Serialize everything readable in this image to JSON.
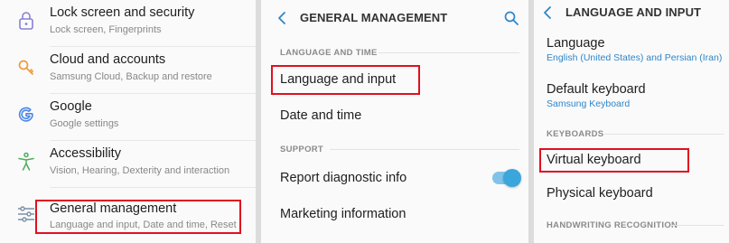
{
  "panel1": {
    "items": [
      {
        "title": "Lock screen and security",
        "subtitle": "Lock screen, Fingerprints",
        "icon": "lock-icon"
      },
      {
        "title": "Cloud and accounts",
        "subtitle": "Samsung Cloud, Backup and restore",
        "icon": "key-icon"
      },
      {
        "title": "Google",
        "subtitle": "Google settings",
        "icon": "google-icon"
      },
      {
        "title": "Accessibility",
        "subtitle": "Vision, Hearing, Dexterity and interaction",
        "icon": "accessibility-icon"
      },
      {
        "title": "General management",
        "subtitle": "Language and input, Date and time, Reset",
        "icon": "sliders-icon"
      }
    ]
  },
  "panel2": {
    "title": "GENERAL MANAGEMENT",
    "section1": "LANGUAGE AND TIME",
    "language_input": "Language and input",
    "date_time": "Date and time",
    "section2": "SUPPORT",
    "report_diag": "Report diagnostic info",
    "report_diag_enabled": true,
    "marketing": "Marketing information"
  },
  "panel3": {
    "title": "LANGUAGE AND INPUT",
    "language": "Language",
    "language_value": "English (United States) and Persian (Iran)",
    "default_keyboard": "Default keyboard",
    "default_keyboard_value": "Samsung Keyboard",
    "section_keyboards": "KEYBOARDS",
    "virtual_keyboard": "Virtual keyboard",
    "physical_keyboard": "Physical keyboard",
    "section_handwriting": "HANDWRITING RECOGNITION"
  },
  "colors": {
    "accent": "#2f86c9",
    "highlight": "#e0101f",
    "lock_icon": "#8a7fd6",
    "key_icon": "#f09a3c",
    "google_icon": "#4a86e8",
    "accessibility_icon": "#4cae5a",
    "sliders_icon": "#7a8ea8"
  }
}
